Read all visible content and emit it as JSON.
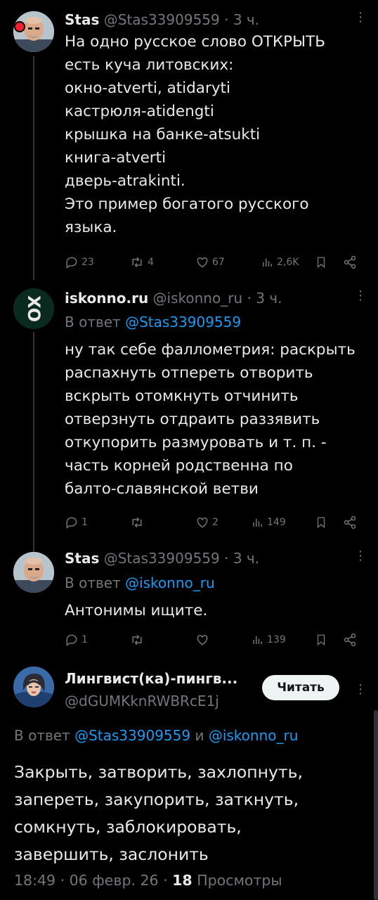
{
  "posts": [
    {
      "author": "Stas",
      "handle": "@Stas33909559",
      "time": "· 3 ч.",
      "text": "На одно русское слово ОТКРЫТЬ\nесть куча литовских:\nокно-atverti, atidaryti\nкастрюля-atidengti\nкрышка на банке-atsukti\nкнига-atverti\nдверь-atrakinti.\nЭто пример богатого русского\nязыка.",
      "stats": {
        "replies": "23",
        "reposts": "4",
        "likes": "67",
        "views": "2,6K"
      }
    },
    {
      "author": "iskonno.ru",
      "handle": "@iskonno_ru",
      "time": "· 3 ч.",
      "reply_prefix": "В ответ",
      "reply_to": "@Stas33909559",
      "avatar_text": "XO",
      "text": "ну так себе фаллометрия: раскрыть\nраспахнуть  отпереть отворить\nвскрыть отомкнуть отчинить\nотверзнуть отдраить раззявить\nоткупорить размуровать и т. п. -\nчасть корней родственна по\nбалто-славянской ветви",
      "stats": {
        "replies": "1",
        "reposts": "",
        "likes": "2",
        "views": "149"
      }
    },
    {
      "author": "Stas",
      "handle": "@Stas33909559",
      "time": "· 3 ч.",
      "reply_prefix": "В ответ",
      "reply_to": "@iskonno_ru",
      "text": "Антонимы ищите.",
      "stats": {
        "replies": "1",
        "reposts": "",
        "likes": "",
        "views": "139"
      }
    }
  ],
  "main": {
    "author": "Лингвист(ка)-пингв...",
    "handle": "@dGUMKknRWBRcE1j",
    "follow_label": "Читать",
    "reply_prefix": "В ответ",
    "reply_to_1": "@Stas33909559",
    "conj": "и",
    "reply_to_2": "@iskonno_ru",
    "text": "Закрыть, затворить, захлопнуть,\nзапереть, закупорить, заткнуть,\nсомкнуть, заблокировать,\nзавершить, заслонить",
    "time": "18:49 · 06 февр. 26 ·",
    "views_count": "18",
    "views_label": "Просмотры"
  },
  "colors": {
    "accent": "#1d9bf0",
    "muted": "#71767b",
    "background": "#000000"
  }
}
